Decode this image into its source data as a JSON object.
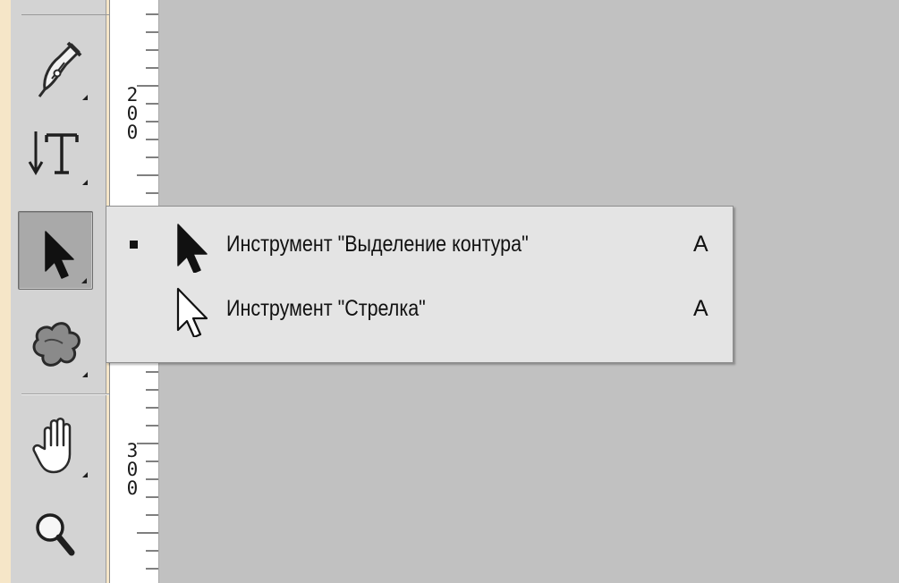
{
  "toolbar": {
    "tools": [
      {
        "name": "pen-tool",
        "icon": "pen-icon",
        "active": false
      },
      {
        "name": "vertical-type-tool",
        "icon": "vertical-type-icon",
        "active": false
      },
      {
        "name": "path-selection-tool",
        "icon": "path-selection-arrow-icon",
        "active": true
      },
      {
        "name": "custom-shape-tool",
        "icon": "custom-shape-icon",
        "active": false
      },
      {
        "name": "hand-tool",
        "icon": "hand-icon",
        "active": false
      },
      {
        "name": "zoom-tool",
        "icon": "magnifier-icon",
        "active": false
      }
    ]
  },
  "ruler": {
    "labels": [
      {
        "text": "200",
        "digits": [
          "2",
          "0",
          "0"
        ]
      },
      {
        "text": "300",
        "digits": [
          "3",
          "0",
          "0"
        ]
      }
    ]
  },
  "flyout": {
    "items": [
      {
        "label": "Инструмент \"Выделение контура\"",
        "shortcut": "A",
        "selected": true,
        "icon": "solid-arrow-icon"
      },
      {
        "label": "Инструмент \"Стрелка\"",
        "shortcut": "A",
        "selected": false,
        "icon": "hollow-arrow-icon"
      }
    ]
  },
  "colors": {
    "background_frame": "#f6e6c8",
    "toolbar": "#d3d3d3",
    "canvas": "#c1c1c1",
    "flyout": "#e4e4e4",
    "ruler": "#ffffff"
  }
}
